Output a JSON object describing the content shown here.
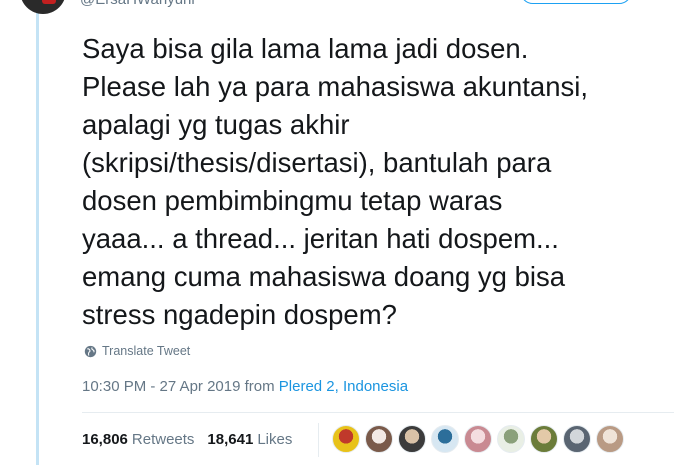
{
  "author": {
    "handle": "@ErsaHWahyuni"
  },
  "tweet": {
    "text": "Saya bisa gila lama lama jadi dosen.\nPlease lah ya para mahasiswa akuntansi,\napalagi yg tugas akhir\n(skripsi/thesis/disertasi), bantulah para\ndosen pembimbingmu tetap waras\nyaaa... a thread... jeritan hati dospem...\nemang cuma mahasiswa doang yg bisa\nstress ngadepin dospem?"
  },
  "translate": {
    "label": "Translate Tweet",
    "icon": "globe-icon"
  },
  "meta": {
    "timestamp": "10:30 PM - 27 Apr 2019",
    "from_label": "from",
    "location": "Plered 2, Indonesia"
  },
  "stats": {
    "retweets_count": "16,806",
    "retweets_label": "Retweets",
    "likes_count": "18,641",
    "likes_label": "Likes"
  },
  "likers": [
    {
      "color": "#e8c21a",
      "accent": "#c0392b"
    },
    {
      "color": "#7a5a4a",
      "accent": "#f2e9e4"
    },
    {
      "color": "#3b3b3b",
      "accent": "#d9c2a7"
    },
    {
      "color": "#d7e7f2",
      "accent": "#2c6e9a"
    },
    {
      "color": "#c98a92",
      "accent": "#f4dde0"
    },
    {
      "color": "#e9efe5",
      "accent": "#8aa07a"
    },
    {
      "color": "#6b7c3a",
      "accent": "#e3c9a8"
    },
    {
      "color": "#5a6572",
      "accent": "#d2d6da"
    },
    {
      "color": "#b99a84",
      "accent": "#efe3d8"
    }
  ],
  "colors": {
    "link": "#1b95e0",
    "secondary": "#657786",
    "thread_line": "#c4e3f5"
  }
}
